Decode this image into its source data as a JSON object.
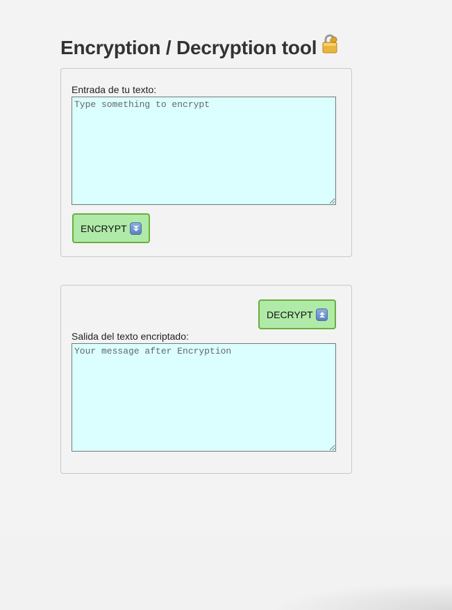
{
  "page": {
    "title": "Encryption / Decryption tool",
    "title_icon": "lock-with-key-icon"
  },
  "encrypt_panel": {
    "label": "Entrada de tu texto:",
    "placeholder": "Type something to encrypt",
    "value": "",
    "button_label": "ENCRYPT",
    "button_icon": "double-down-arrow-icon"
  },
  "decrypt_panel": {
    "button_label": "DECRYPT",
    "button_icon": "double-up-arrow-icon",
    "label": "Salida del texto encriptado:",
    "placeholder": "Your message after Encryption",
    "value": ""
  },
  "colors": {
    "textarea_bg": "#dbffff",
    "button_bg": "#b0eaa8",
    "button_border": "#6aad3c",
    "page_bg": "#f3f3f3"
  }
}
